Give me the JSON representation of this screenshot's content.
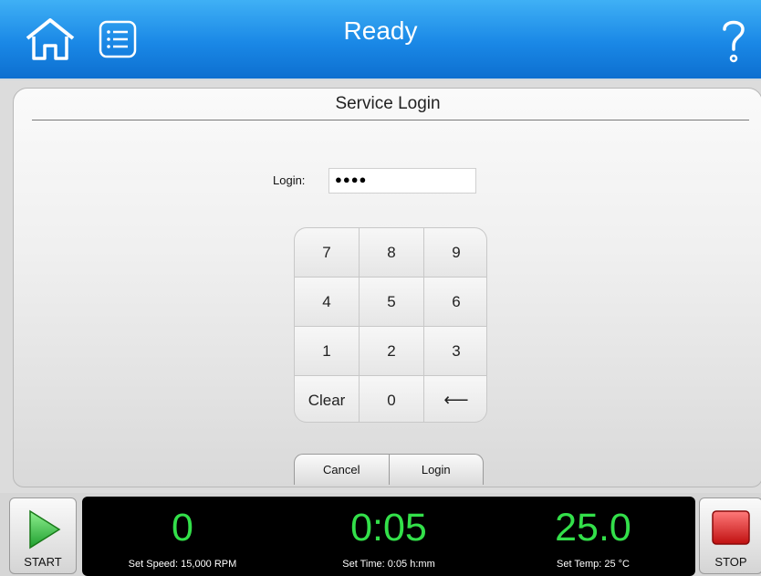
{
  "header": {
    "title": "Ready",
    "icons": {
      "home": "home-icon",
      "menu": "list-icon",
      "help": "help-icon"
    },
    "accent_color": "#1a88e6"
  },
  "dialog": {
    "title": "Service Login",
    "login_label": "Login:",
    "login_value": "●●●●",
    "keypad": [
      "7",
      "8",
      "9",
      "4",
      "5",
      "6",
      "1",
      "2",
      "3",
      "Clear",
      "0",
      "⟵"
    ],
    "cancel_label": "Cancel",
    "login_button_label": "Login"
  },
  "controls": {
    "start_label": "START",
    "stop_label": "STOP",
    "start_color": "#3fbf3f",
    "stop_color": "#e02020"
  },
  "readouts": {
    "speed_value": "0",
    "speed_label": "Set Speed: 15,000 RPM",
    "time_value": "0:05",
    "time_label": "Set Time: 0:05 h:mm",
    "temp_value": "25.0",
    "temp_label": "Set Temp: 25 °C",
    "value_color": "#33e04a"
  }
}
